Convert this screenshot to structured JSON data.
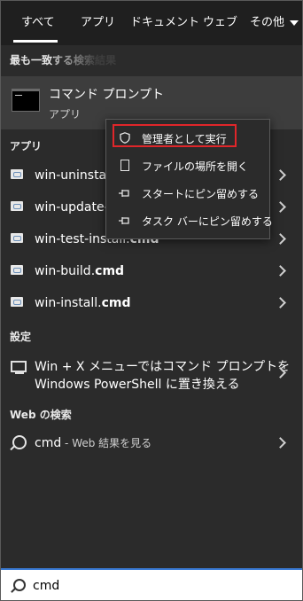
{
  "tabs": [
    {
      "label": "すべて"
    },
    {
      "label": "アプリ"
    },
    {
      "label": "ドキュメント"
    },
    {
      "label": "ウェブ"
    },
    {
      "label": "その他"
    }
  ],
  "best_match": {
    "header": "最も一致する検索結果",
    "title": "コマンド プロンプト",
    "subtitle": "アプリ"
  },
  "apps": {
    "header": "アプリ",
    "items": [
      {
        "label_plain": "win-uninstal",
        "label_bold": ""
      },
      {
        "label_plain": "win-update-",
        "label_bold": ""
      },
      {
        "label_plain": "win-test-install.",
        "label_bold": "cmd"
      },
      {
        "label_plain": "win-build.",
        "label_bold": "cmd"
      },
      {
        "label_plain": "win-install.",
        "label_bold": "cmd"
      }
    ]
  },
  "settings": {
    "header": "設定",
    "line1": "Win + X メニューではコマンド プロンプトを",
    "line2": "Windows PowerShell に置き換える"
  },
  "web": {
    "header": "Web の検索",
    "query": "cmd",
    "suffix": " - Web 結果を見る"
  },
  "context_menu": {
    "items": [
      {
        "label": "管理者として実行",
        "icon": "shield-icon"
      },
      {
        "label": "ファイルの場所を開く",
        "icon": "folder-icon"
      },
      {
        "label": "スタートにピン留めする",
        "icon": "pin-icon"
      },
      {
        "label": "タスク バーにピン留めする",
        "icon": "pin-icon"
      }
    ],
    "highlight_color": "#e0262a"
  },
  "searchbar": {
    "value": "cmd"
  },
  "colors": {
    "background": "#2b2b2b",
    "tabbar": "#1f1f1f",
    "selected_item": "#3d3d3d",
    "accent": "#3a7bd5"
  }
}
